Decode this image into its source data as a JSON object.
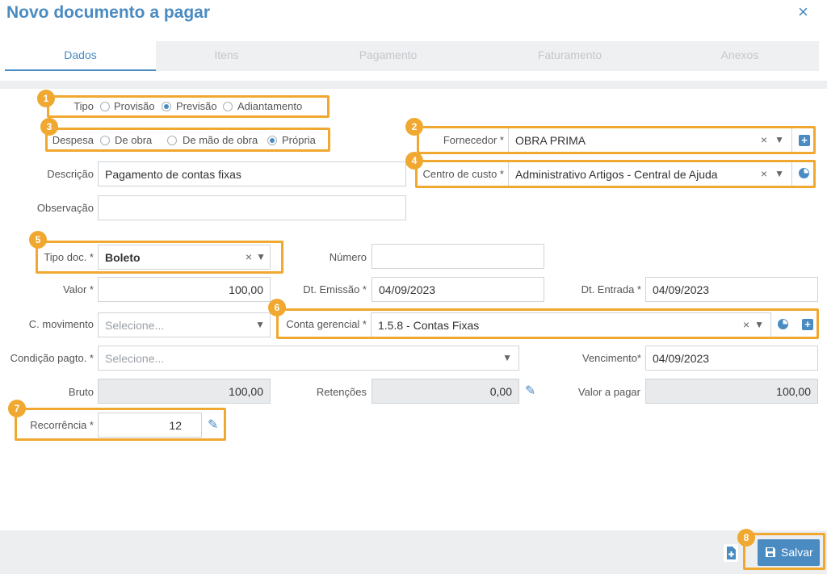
{
  "header": {
    "title": "Novo documento a pagar",
    "close_glyph": "×"
  },
  "tabs": [
    {
      "label": "Dados",
      "active": true
    },
    {
      "label": "Itens",
      "active": false
    },
    {
      "label": "Pagamento",
      "active": false
    },
    {
      "label": "Faturamento",
      "active": false
    },
    {
      "label": "Anexos",
      "active": false
    }
  ],
  "form": {
    "tipo": {
      "label": "Tipo",
      "options": [
        "Provisão",
        "Previsão",
        "Adiantamento"
      ],
      "selected": "Previsão"
    },
    "despesa": {
      "label": "Despesa",
      "options": [
        "De obra",
        "De mão de obra",
        "Própria"
      ],
      "selected": "Própria"
    },
    "fornecedor": {
      "label": "Fornecedor *",
      "value": "OBRA PRIMA"
    },
    "descricao": {
      "label": "Descrição",
      "value": "Pagamento de contas fixas"
    },
    "centro_custo": {
      "label": "Centro de custo *",
      "value": "Administrativo Artigos - Central de Ajuda"
    },
    "observacao": {
      "label": "Observação",
      "value": ""
    },
    "tipo_doc": {
      "label": "Tipo doc. *",
      "value": "Boleto"
    },
    "numero": {
      "label": "Número",
      "value": ""
    },
    "valor": {
      "label": "Valor *",
      "value": "100,00"
    },
    "dt_emissao": {
      "label": "Dt. Emissão *",
      "value": "04/09/2023"
    },
    "dt_entrada": {
      "label": "Dt. Entrada *",
      "value": "04/09/2023"
    },
    "c_movimento": {
      "label": "C. movimento",
      "placeholder": "Selecione..."
    },
    "conta_gerencial": {
      "label": "Conta gerencial *",
      "value": "1.5.8 - Contas Fixas"
    },
    "condicao_pagto": {
      "label": "Condição pagto. *",
      "placeholder": "Selecione..."
    },
    "vencimento": {
      "label": "Vencimento*",
      "value": "04/09/2023"
    },
    "bruto": {
      "label": "Bruto",
      "value": "100,00"
    },
    "retencoes": {
      "label": "Retenções",
      "value": "0,00"
    },
    "valor_pagar": {
      "label": "Valor a pagar",
      "value": "100,00"
    },
    "recorrencia": {
      "label": "Recorrência *",
      "value": "12"
    }
  },
  "badges": [
    "1",
    "2",
    "3",
    "4",
    "5",
    "6",
    "7",
    "8"
  ],
  "footer": {
    "save_label": "Salvar"
  },
  "glyphs": {
    "clear": "×",
    "caret": "▼",
    "plus": "+",
    "pencil": "✎"
  },
  "icons": [
    "close-icon",
    "radio-icon",
    "clear-icon",
    "chevron-down-icon",
    "add-icon",
    "pie-chart-icon",
    "pencil-icon",
    "save-icon",
    "new-document-icon"
  ],
  "colors": {
    "accent": "#4a8bc2",
    "highlight": "#f0a830"
  }
}
